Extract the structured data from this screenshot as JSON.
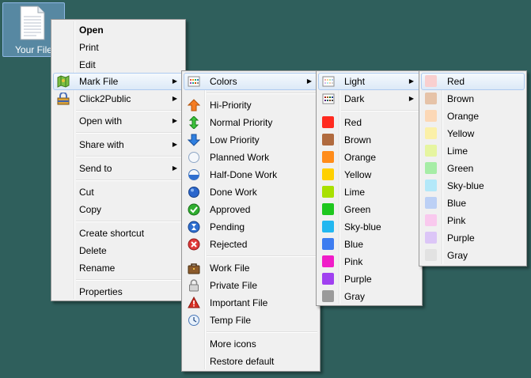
{
  "desktop": {
    "file_label": "Your File"
  },
  "main_menu": [
    {
      "label": "Open",
      "bold": true
    },
    {
      "label": "Print"
    },
    {
      "label": "Edit"
    },
    {
      "label": "Mark File",
      "submenu": true,
      "icon": "map-icon",
      "highlight": true
    },
    {
      "label": "Click2Public",
      "submenu": true,
      "icon": "lock-box-icon"
    },
    {
      "label": "Open with",
      "submenu": true
    },
    {
      "label": "Share with",
      "submenu": true
    },
    {
      "label": "Send to",
      "submenu": true
    },
    {
      "label": "Cut"
    },
    {
      "label": "Copy"
    },
    {
      "label": "Create shortcut"
    },
    {
      "label": "Delete"
    },
    {
      "label": "Rename"
    },
    {
      "label": "Properties"
    }
  ],
  "mark_menu": [
    {
      "label": "Colors",
      "submenu": true,
      "icon": "palette-grid-icon",
      "highlight": true
    },
    {
      "label": "Hi-Priority",
      "icon": "arrow-up-icon"
    },
    {
      "label": "Normal Priority",
      "icon": "arrow-updown-icon"
    },
    {
      "label": "Low Priority",
      "icon": "arrow-down-icon"
    },
    {
      "label": "Planned Work",
      "icon": "empty-circle-icon"
    },
    {
      "label": "Half-Done Work",
      "icon": "half-circle-icon"
    },
    {
      "label": "Done Work",
      "icon": "full-circle-icon"
    },
    {
      "label": "Approved",
      "icon": "check-icon"
    },
    {
      "label": "Pending",
      "icon": "hourglass-icon"
    },
    {
      "label": "Rejected",
      "icon": "reject-icon"
    },
    {
      "label": "Work File",
      "icon": "briefcase-icon"
    },
    {
      "label": "Private File",
      "icon": "padlock-icon"
    },
    {
      "label": "Important File",
      "icon": "warning-icon"
    },
    {
      "label": "Temp File",
      "icon": "clock-icon"
    },
    {
      "label": "More icons"
    },
    {
      "label": "Restore default"
    }
  ],
  "colors_menu": [
    {
      "label": "Light",
      "submenu": true,
      "highlight": true,
      "icon": "palette-grid-icon"
    },
    {
      "label": "Dark",
      "submenu": true,
      "icon": "palette-grid-icon"
    },
    {
      "label": "Red",
      "color": "#ff2a1f"
    },
    {
      "label": "Brown",
      "color": "#b06a3e"
    },
    {
      "label": "Orange",
      "color": "#ff8c1a"
    },
    {
      "label": "Yellow",
      "color": "#ffd000"
    },
    {
      "label": "Lime",
      "color": "#a8e000"
    },
    {
      "label": "Green",
      "color": "#1ec71e"
    },
    {
      "label": "Sky-blue",
      "color": "#22b7f0"
    },
    {
      "label": "Blue",
      "color": "#3d7cf0"
    },
    {
      "label": "Pink",
      "color": "#f01cc8"
    },
    {
      "label": "Purple",
      "color": "#a040f0"
    },
    {
      "label": "Gray",
      "color": "#9a9a9a"
    }
  ],
  "light_menu": [
    {
      "label": "Red",
      "color": "#f9cfcf",
      "highlight": true
    },
    {
      "label": "Brown",
      "color": "#e6c3a8"
    },
    {
      "label": "Orange",
      "color": "#fcd8b6"
    },
    {
      "label": "Yellow",
      "color": "#fbf0a8"
    },
    {
      "label": "Lime",
      "color": "#e6f5a0"
    },
    {
      "label": "Green",
      "color": "#a6eda6"
    },
    {
      "label": "Sky-blue",
      "color": "#b3e8f9"
    },
    {
      "label": "Blue",
      "color": "#bcd0f5"
    },
    {
      "label": "Pink",
      "color": "#f9c9ee"
    },
    {
      "label": "Purple",
      "color": "#dcc6f7"
    },
    {
      "label": "Gray",
      "color": "#e2e2e2"
    }
  ]
}
